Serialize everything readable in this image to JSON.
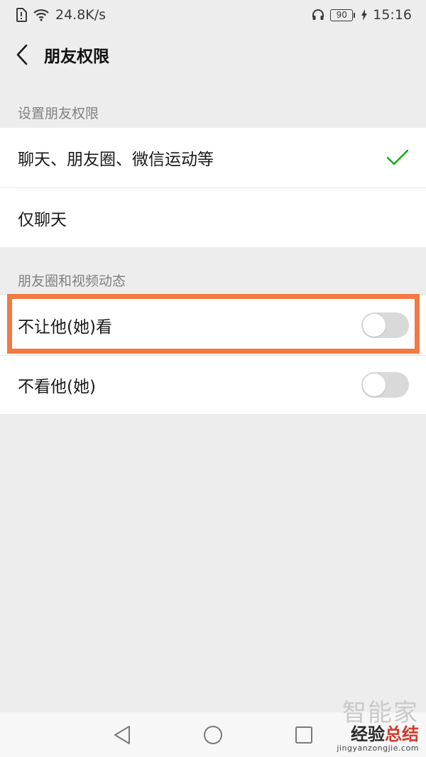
{
  "status_bar": {
    "net_speed": "24.8K/s",
    "battery": "90",
    "time": "15:16"
  },
  "nav": {
    "title": "朋友权限"
  },
  "sections": [
    {
      "label": "设置朋友权限",
      "items": [
        {
          "label": "聊天、朋友圈、微信运动等",
          "selected": true
        },
        {
          "label": "仅聊天",
          "selected": false
        }
      ]
    },
    {
      "label": "朋友圈和视频动态",
      "items": [
        {
          "label": "不让他(她)看",
          "on": false
        },
        {
          "label": "不看他(她)",
          "on": false
        }
      ]
    }
  ],
  "watermark": {
    "top": "智能家",
    "main_a": "经验",
    "main_b": "总结",
    "url": "jingyanzongjie.com"
  },
  "colors": {
    "check": "#1aad19",
    "highlight": "#f47842",
    "toggle_off": "#d9d9d9"
  }
}
